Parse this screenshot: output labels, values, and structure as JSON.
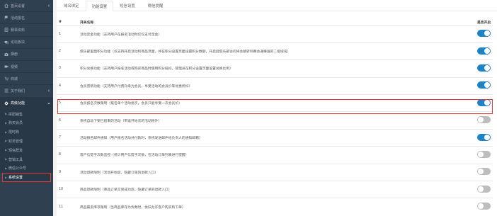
{
  "sidebar": {
    "items": [
      {
        "label": "首页设置",
        "icon": "home-icon",
        "chevron": true
      },
      {
        "label": "活动报名",
        "icon": "flag-icon",
        "chevron": false
      },
      {
        "label": "赛事资料",
        "icon": "document-icon",
        "chevron": false
      },
      {
        "label": "论坛板块",
        "icon": "comments-icon",
        "chevron": false
      },
      {
        "label": "相册",
        "icon": "camera-icon",
        "chevron": false
      },
      {
        "label": "视频",
        "icon": "video-icon",
        "chevron": false
      },
      {
        "label": "商城",
        "icon": "cart-icon",
        "chevron": false
      },
      {
        "label": "关于我们",
        "icon": "info-icon",
        "chevron": true
      },
      {
        "label": "高级功能",
        "icon": "cogs-icon",
        "chevron": true
      }
    ],
    "sub_items": [
      {
        "label": "拼团销售"
      },
      {
        "label": "购买会员"
      },
      {
        "label": "限时购"
      },
      {
        "label": "财务管理"
      },
      {
        "label": "短信群发"
      },
      {
        "label": "营销工具"
      },
      {
        "label": "微信公众号"
      },
      {
        "label": "系统设置"
      }
    ]
  },
  "tabs": [
    "域名绑定",
    "功能设置",
    "短信设置",
    "微信提醒"
  ],
  "active_tab": 1,
  "table": {
    "headers": [
      "#",
      "开关名称",
      "是否开启"
    ],
    "rows": [
      {
        "num": "1",
        "name": "活动定金功能（支持用户在报名活动时仅仅支付定金）",
        "on": true
      },
      {
        "num": "2",
        "name": "俱乐部里面积分功能（仅支持开启活动和商品页面，并在积分设置页面设置积分数额，开启后俱乐部访问将会跳转到赛会通赚送的二级域名）",
        "on": true
      },
      {
        "num": "3",
        "name": "积分兑换功能（支持用户报名活动或购买商品时使用积分抵扣，管理员在积分设置页面设置兑换比例）",
        "on": true
      },
      {
        "num": "4",
        "name": "会员营销功能（支持用户付费升级为会员，享受活动的会员价等优惠折扣）",
        "on": true
      },
      {
        "num": "5",
        "name": "会员报名次数限制（报名单个活动批次，会员只能享受一次会员价）",
        "on": true
      },
      {
        "num": "6",
        "name": "系统自动下架已结束的活动（带遥开始次的活动除外）",
        "on": false
      },
      {
        "num": "7",
        "name": "活动报名邮件通知（用户报名活动并付款时，系统发送邮件给负责人的通知邮箱）",
        "on": true
      },
      {
        "num": "8",
        "name": "客户信提子次数监控（统计用户信提子次数，在活动订单列表进行提醒）",
        "on": false
      },
      {
        "num": "9",
        "name": "活动退款限制（活动开始后，隐藏订单的退款入口）",
        "on": false
      },
      {
        "num": "10",
        "name": "商品退款限制（商品订单交易成功后，隐藏订单的退款入口）",
        "on": false
      },
      {
        "num": "11",
        "name": "商品最卖库存限制（当商品库存为负数时，依旧允许客户购买和下单）",
        "on": false
      }
    ]
  },
  "colors": {
    "sidebar_bg": "#2f4050",
    "toggle_on": "#1c84c6",
    "toggle_off": "#bdbdbd",
    "highlight": "#e53935"
  }
}
